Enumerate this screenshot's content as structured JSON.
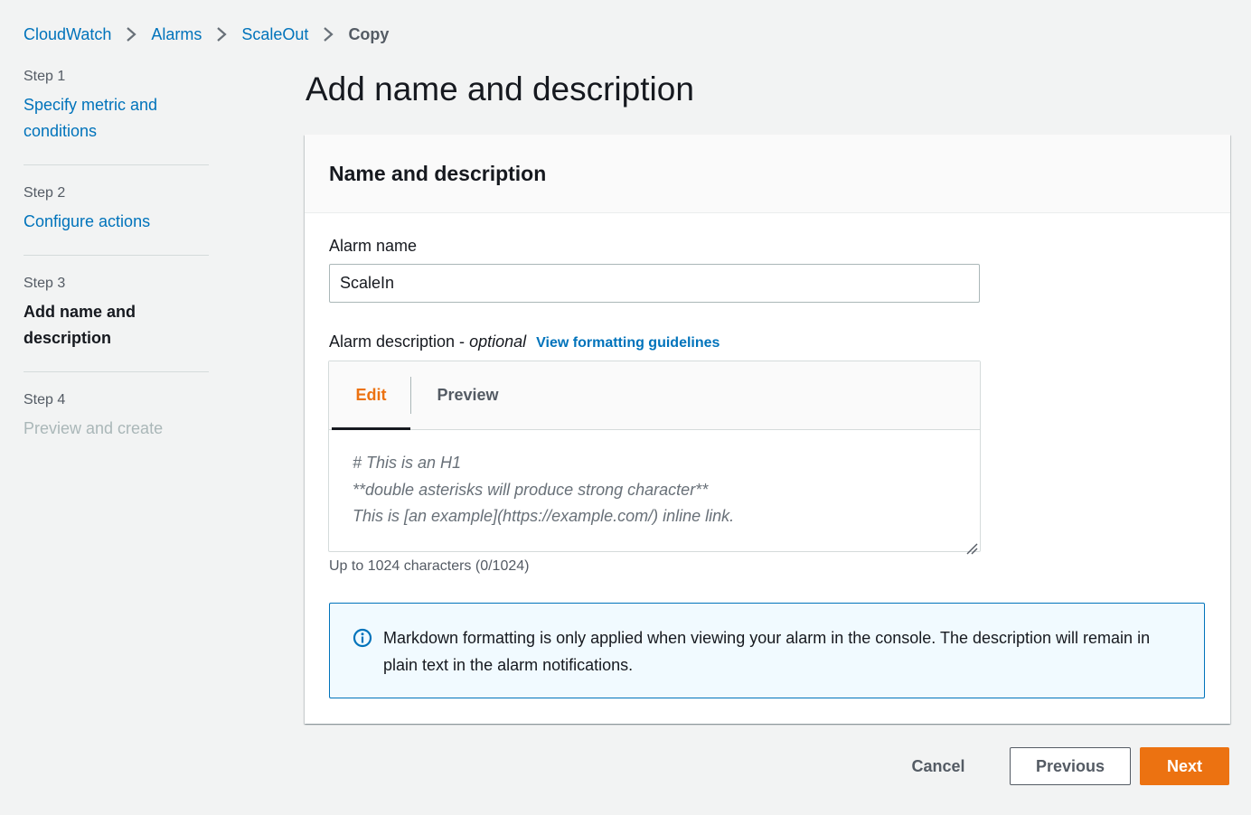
{
  "breadcrumb": {
    "items": [
      {
        "label": "CloudWatch"
      },
      {
        "label": "Alarms"
      },
      {
        "label": "ScaleOut"
      }
    ],
    "current": "Copy",
    "separator_icon": "chevron-right-icon"
  },
  "steps": [
    {
      "step": "Step 1",
      "title": "Specify metric and conditions",
      "state": "link"
    },
    {
      "step": "Step 2",
      "title": "Configure actions",
      "state": "link"
    },
    {
      "step": "Step 3",
      "title": "Add name and description",
      "state": "current"
    },
    {
      "step": "Step 4",
      "title": "Preview and create",
      "state": "disabled"
    }
  ],
  "page": {
    "title": "Add name and description"
  },
  "container": {
    "title": "Name and description",
    "alarm_name": {
      "label": "Alarm name",
      "value": "ScaleIn"
    },
    "alarm_description": {
      "label": "Alarm description - ",
      "optional": "optional",
      "guidelines_link": "View formatting guidelines",
      "tabs": [
        {
          "label": "Edit",
          "active": true
        },
        {
          "label": "Preview",
          "active": false
        }
      ],
      "placeholder_lines": [
        "# This is an H1",
        "**double asterisks will produce strong character**",
        "This is [an example](https://example.com/) inline link."
      ],
      "constraint": "Up to 1024 characters (0/1024)"
    },
    "info_alert": {
      "icon": "info-icon",
      "text": "Markdown formatting is only applied when viewing your alarm in the console. The description will remain in plain text in the alarm notifications."
    }
  },
  "actions": {
    "cancel": "Cancel",
    "previous": "Previous",
    "next": "Next"
  },
  "colors": {
    "link": "#0073bb",
    "primary": "#ec7211",
    "background": "#f2f3f3",
    "alert_background": "#f1faff"
  }
}
